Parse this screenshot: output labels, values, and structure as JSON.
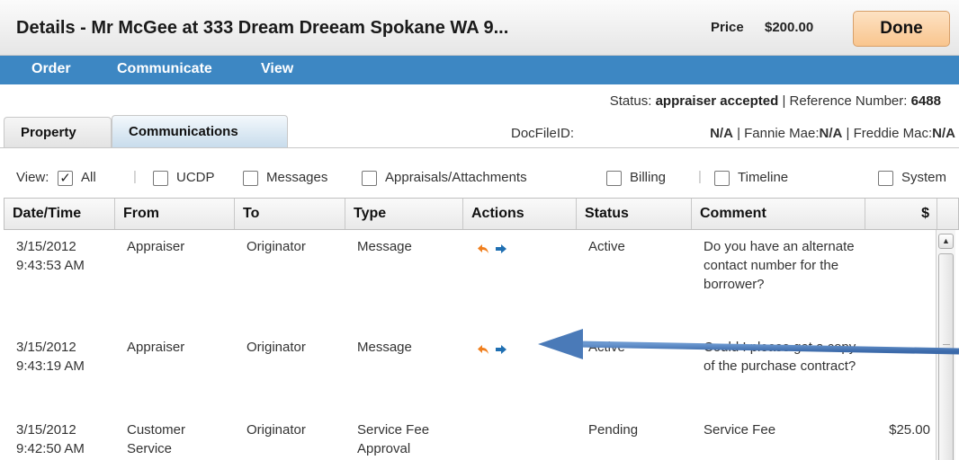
{
  "header": {
    "title": "Details - Mr McGee at 333 Dream Dreeam Spokane  WA 9...",
    "price_label": "Price",
    "price_value": "$200.00",
    "done_label": "Done"
  },
  "menu": [
    "Order",
    "Communicate",
    "View"
  ],
  "status": {
    "status_label": "Status:",
    "status_value": "appraiser accepted",
    "ref_label": "| Reference Number:",
    "ref_value": "6488"
  },
  "tabs": [
    {
      "label": "Property",
      "active": false
    },
    {
      "label": "Communications",
      "active": true
    }
  ],
  "docfile": {
    "label": "DocFileID:",
    "value": "N/A",
    "fannie_label": "| Fannie Mae:",
    "fannie_value": "N/A",
    "freddie_label": "| Freddie Mac:",
    "freddie_value": "N/A"
  },
  "filters": {
    "view_label": "View:",
    "options": [
      {
        "label": "All",
        "checked": true
      },
      {
        "label": "UCDP",
        "checked": false
      },
      {
        "label": "Messages",
        "checked": false
      },
      {
        "label": "Appraisals/Attachments",
        "checked": false
      },
      {
        "label": "Billing",
        "checked": false
      },
      {
        "label": "Timeline",
        "checked": false
      },
      {
        "label": "System",
        "checked": false
      }
    ],
    "check_mark": "✓",
    "separator": "|"
  },
  "table": {
    "columns": [
      "Date/Time",
      "From",
      "To",
      "Type",
      "Actions",
      "Status",
      "Comment",
      "$"
    ],
    "rows": [
      {
        "date": "3/15/2012",
        "time": "9:43:53 AM",
        "from": "Appraiser",
        "to": "Originator",
        "type": "Message",
        "has_actions": true,
        "status": "Active",
        "comment": "Do you have an alternate contact number for the borrower?",
        "amount": ""
      },
      {
        "date": "3/15/2012",
        "time": "9:43:19 AM",
        "from": "Appraiser",
        "to": "Originator",
        "type": "Message",
        "has_actions": true,
        "status": "Active",
        "comment": "Could I please get a copy of the purchase contract?",
        "amount": ""
      },
      {
        "date": "3/15/2012",
        "time": "9:42:50 AM",
        "from": "Customer Service",
        "to": "Originator",
        "type": "Service Fee Approval",
        "has_actions": false,
        "status": "Pending",
        "comment": "Service Fee",
        "amount": "$25.00"
      }
    ]
  },
  "colors": {
    "menu_bar": "#3d87c3",
    "done_button": "#f9c58e",
    "reply_icon": "#f07f1e",
    "forward_icon": "#1f6fb2",
    "annotation_arrow": "#4a7ab8"
  },
  "icons": {
    "reply": "reply-arrow-icon",
    "forward": "forward-arrow-icon",
    "annotation": "annotation-arrow"
  }
}
